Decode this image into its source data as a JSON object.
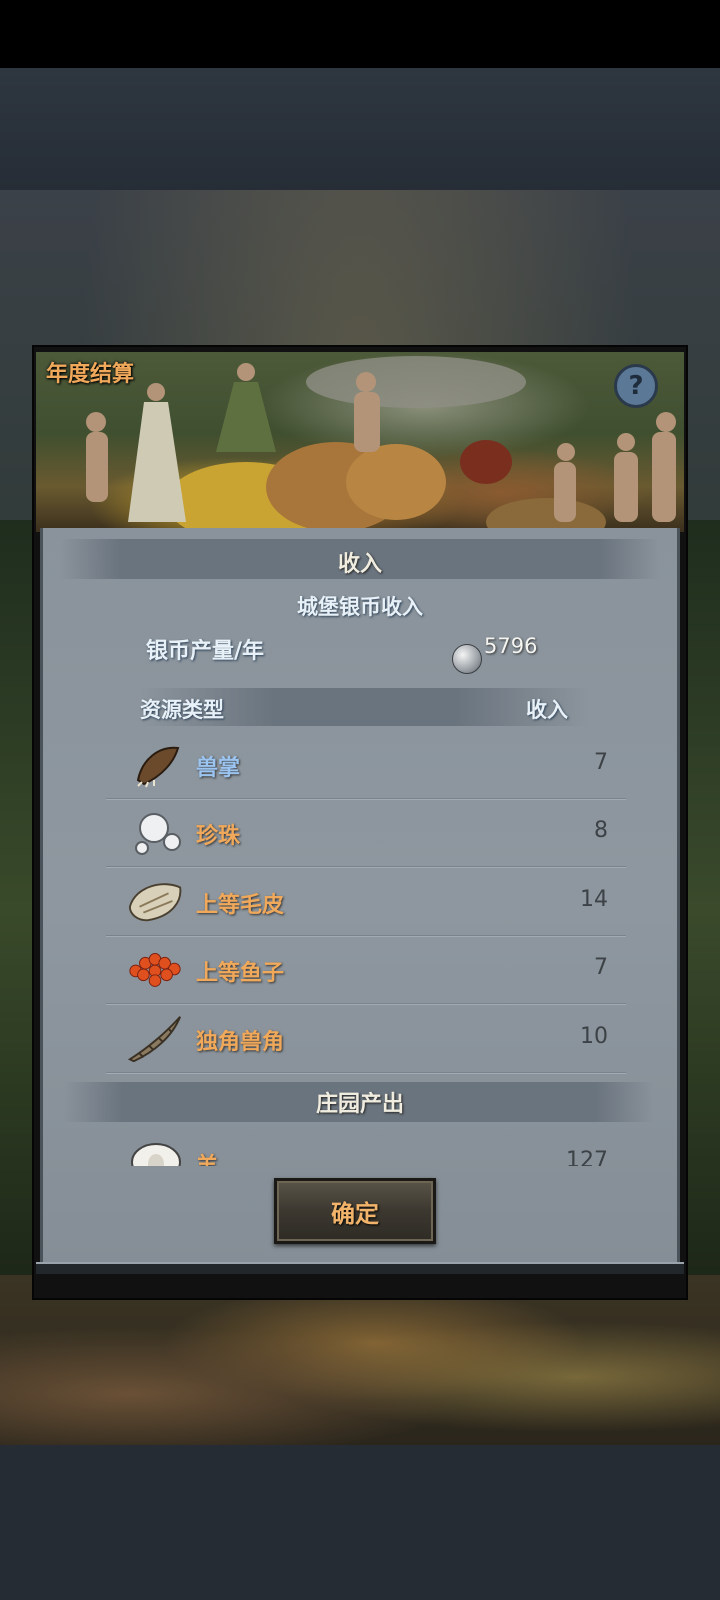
{
  "dialog": {
    "title": "年度结算",
    "help_symbol": "?",
    "income_section_title": "收入",
    "castle_silver_title": "城堡银币收入",
    "silver_label": "银币产量/年",
    "silver_value": "5796",
    "table": {
      "col_type": "资源类型",
      "col_income": "收入",
      "rows": [
        {
          "name": "兽掌",
          "value": "7",
          "color": "#9bc4f0",
          "icon": "beast-paw-icon"
        },
        {
          "name": "珍珠",
          "value": "8",
          "color": "#f0a85a",
          "icon": "pearl-icon"
        },
        {
          "name": "上等毛皮",
          "value": "14",
          "color": "#f0a85a",
          "icon": "fur-icon"
        },
        {
          "name": "上等鱼子",
          "value": "7",
          "color": "#f0a85a",
          "icon": "fish-roe-icon"
        },
        {
          "name": "独角兽角",
          "value": "10",
          "color": "#f0a85a",
          "icon": "unicorn-horn-icon"
        }
      ]
    },
    "manor_section_title": "庄园产出",
    "manor_rows": [
      {
        "name": "羊",
        "value": "127",
        "icon": "sheep-icon"
      }
    ],
    "confirm_label": "确定"
  },
  "colors": {
    "title_orange": "#f0a85a",
    "label_blue": "#9bc4f0",
    "panel_grey": "#8a939b"
  }
}
